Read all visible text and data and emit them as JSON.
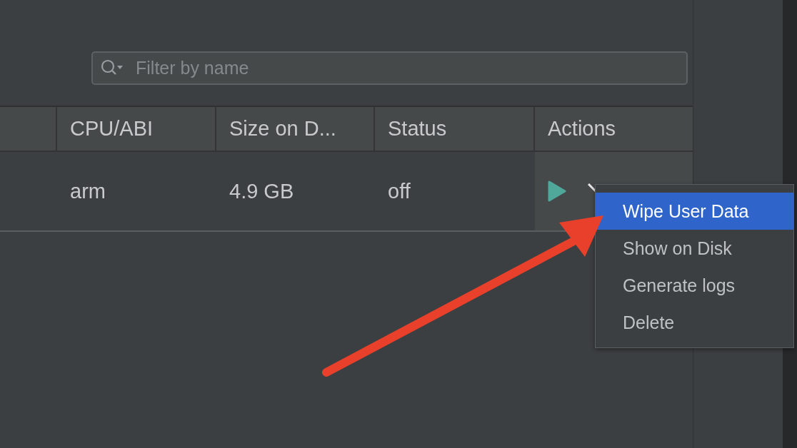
{
  "search": {
    "placeholder": "Filter by name"
  },
  "table": {
    "columns": [
      "",
      "CPU/ABI",
      "Size on D...",
      "Status",
      "Actions"
    ],
    "rows": [
      {
        "cells": [
          "",
          "arm",
          "4.9 GB",
          "off"
        ]
      }
    ]
  },
  "menu": {
    "items": [
      {
        "label": "Wipe User Data",
        "selected": true
      },
      {
        "label": "Show on Disk",
        "selected": false
      },
      {
        "label": "Generate logs",
        "selected": false
      },
      {
        "label": "Delete",
        "selected": false
      }
    ]
  }
}
